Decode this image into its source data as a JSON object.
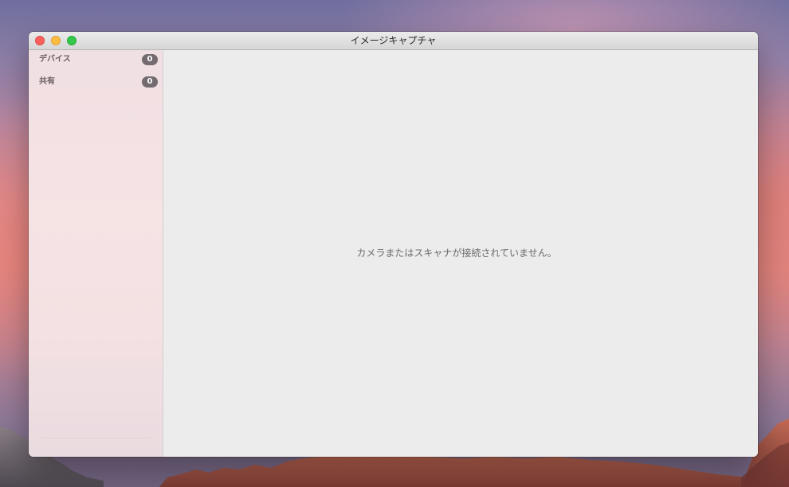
{
  "window": {
    "title": "イメージキャプチャ"
  },
  "sidebar": {
    "items": [
      {
        "label": "デバイス",
        "count": "0"
      },
      {
        "label": "共有",
        "count": "0"
      }
    ]
  },
  "main": {
    "empty_message": "カメラまたはスキャナが接続されていません。"
  },
  "colors": {
    "close": "#fc605c",
    "minimize": "#fdbc40",
    "zoom": "#34c84a",
    "badge": "#736b6f"
  }
}
